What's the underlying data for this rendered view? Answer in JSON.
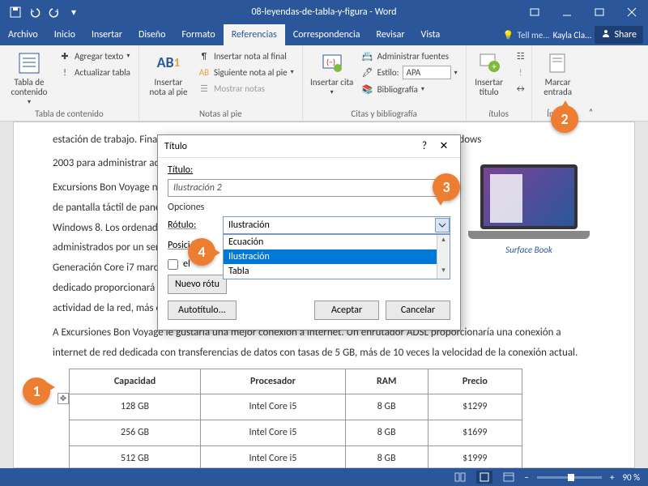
{
  "titlebar": {
    "doc_title": "08-leyendas-de-tabla-y-figura - Word"
  },
  "tabs": {
    "items": [
      "Archivo",
      "Inicio",
      "Insertar",
      "Diseño",
      "Formato",
      "Referencias",
      "Correspondencia",
      "Revisar",
      "Vista"
    ],
    "active_index": 5,
    "tell_me": "Tell me...",
    "user": "Kayla Cla...",
    "share": "Share"
  },
  "ribbon": {
    "toc": {
      "big": "Tabla de contenido",
      "add_text": "Agregar texto",
      "update": "Actualizar tabla",
      "group": "Tabla de contenido"
    },
    "footnotes": {
      "big": "Insertar nota al pie",
      "endnote": "Insertar nota al final",
      "next": "Siguiente nota al pie",
      "show": "Mostrar notas",
      "group": "Notas al pie"
    },
    "citations": {
      "big": "Insertar cita",
      "manage": "Administrar fuentes",
      "style_label": "Estilo:",
      "style_value": "APA",
      "biblio": "Bibliografía",
      "group": "Citas y bibliografía"
    },
    "captions": {
      "big": "Insertar título",
      "group": "ítulos"
    },
    "index": {
      "big": "Marcar entrada",
      "group": "Índice"
    }
  },
  "document": {
    "p1a": "estación de trabajo. Finalmente, Bon Voyage Excursiones requiere un servidor dedicado de Windows",
    "p1b": "2003 para administrar adecuadamente todos los ordenadores, la red y otros recursos.",
    "p2_lines": [
      "Excursions Bon Voyage necesita tres nuevos ordenadores",
      "de pantalla táctil de panel plano y el sistema operativo",
      "Windows 8. Los ordenadores de última generación serían",
      "administrados por un servidor, con procesadores de 4ª",
      "Generación Core i7 marca Intel. Finalmente, el servidor",
      "dedicado proporcionará una administración de monitoreo de",
      "actividad de la red, más eficiente."
    ],
    "p3": "A Excursiones Bon Voyage le gustaría una mejor conexión a internet. Un enrutador ADSL proporcionaría una conexión a internet de red dedicada con transferencias de datos con tasas de 5 GB, más de 10 veces la velocidad de la conexión actual.",
    "laptop_caption": "Surface Book",
    "table": {
      "headers": [
        "Capacidad",
        "Procesador",
        "RAM",
        "Precio"
      ],
      "rows": [
        [
          "128 GB",
          "Intel Core i5",
          "8 GB",
          "$1299"
        ],
        [
          "256 GB",
          "Intel Core i5",
          "8 GB",
          "$1699"
        ],
        [
          "512 GB",
          "Intel Core i5",
          "8 GB",
          "$1999"
        ]
      ]
    }
  },
  "dialog": {
    "title": "Título",
    "caption_label": "Título:",
    "caption_value": "Ilustración 2",
    "options_header": "Opciones",
    "label_label": "Rótulo:",
    "label_value": "Ilustración",
    "dropdown_options": [
      "Ecuación",
      "Ilustración",
      "Tabla"
    ],
    "dropdown_selected_index": 1,
    "position_label": "Posición:",
    "exclude_label": "el",
    "new_label_btn": "Nuevo rótu",
    "autocaption_btn": "Autotítulo...",
    "ok_btn": "Aceptar",
    "cancel_btn": "Cancelar"
  },
  "badges": {
    "b1": "1",
    "b2": "2",
    "b3": "3",
    "b4": "4"
  },
  "status": {
    "zoom": "90 %",
    "minus": "−",
    "plus": "+"
  }
}
